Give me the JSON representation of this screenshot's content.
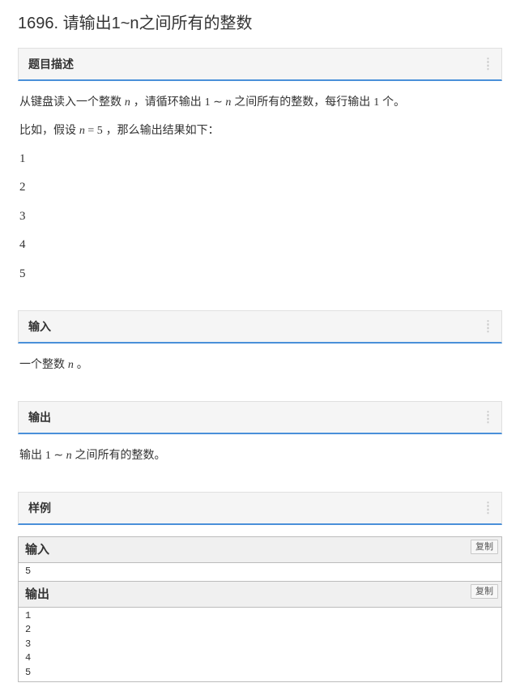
{
  "problem": {
    "id": "1696",
    "title": "请输出1~n之间所有的整数",
    "full_title": "1696. 请输出1~n之间所有的整数"
  },
  "sections": {
    "description": {
      "heading": "题目描述",
      "line1_pre": "从键盘读入一个整数 ",
      "line1_var": "n",
      "line1_mid": " ，请循环输出 ",
      "line1_range_a": "1",
      "line1_tilde": " ∼ ",
      "line1_range_b": "n",
      "line1_post": " 之间所有的整数，每行输出 ",
      "line1_one": "1",
      "line1_end": " 个。",
      "line2_pre": "比如，假设 ",
      "line2_eq_lhs": "n",
      "line2_eq_op": " = ",
      "line2_eq_rhs": "5",
      "line2_post": " ，那么输出结果如下：",
      "example_output": [
        "1",
        "2",
        "3",
        "4",
        "5"
      ]
    },
    "input": {
      "heading": "输入",
      "text_pre": "一个整数 ",
      "text_var": "n",
      "text_post": " 。"
    },
    "output": {
      "heading": "输出",
      "text_pre": "输出 ",
      "range_a": "1",
      "tilde": " ∼ ",
      "range_b": "n",
      "text_post": " 之间所有的整数。"
    },
    "sample": {
      "heading": "样例",
      "input_label": "输入",
      "output_label": "输出",
      "copy_label": "复制",
      "input_data": "5",
      "output_data": "1\n2\n3\n4\n5"
    }
  }
}
